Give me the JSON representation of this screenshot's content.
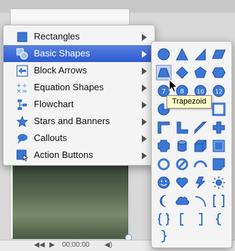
{
  "menu": {
    "items": [
      {
        "label": "Rectangles",
        "icon": "rectangle-icon"
      },
      {
        "label": "Basic Shapes",
        "icon": "basic-shapes-icon"
      },
      {
        "label": "Block Arrows",
        "icon": "block-arrows-icon"
      },
      {
        "label": "Equation Shapes",
        "icon": "equation-shapes-icon"
      },
      {
        "label": "Flowchart",
        "icon": "flowchart-icon"
      },
      {
        "label": "Stars and Banners",
        "icon": "stars-banners-icon"
      },
      {
        "label": "Callouts",
        "icon": "callouts-icon"
      },
      {
        "label": "Action Buttons",
        "icon": "action-buttons-icon"
      }
    ],
    "selected": "Basic Shapes"
  },
  "submenu": {
    "shapes_numbered": [
      "7",
      "8",
      "10",
      "12"
    ],
    "hovered_shape": "trapezoid"
  },
  "tooltip": {
    "text": "Trapezoid"
  },
  "player": {
    "time": "00:00:00"
  },
  "colors": {
    "accent": "#2c5bd1",
    "shape_fill": "#3b78d6",
    "shape_stroke": "#1f4fa3"
  }
}
